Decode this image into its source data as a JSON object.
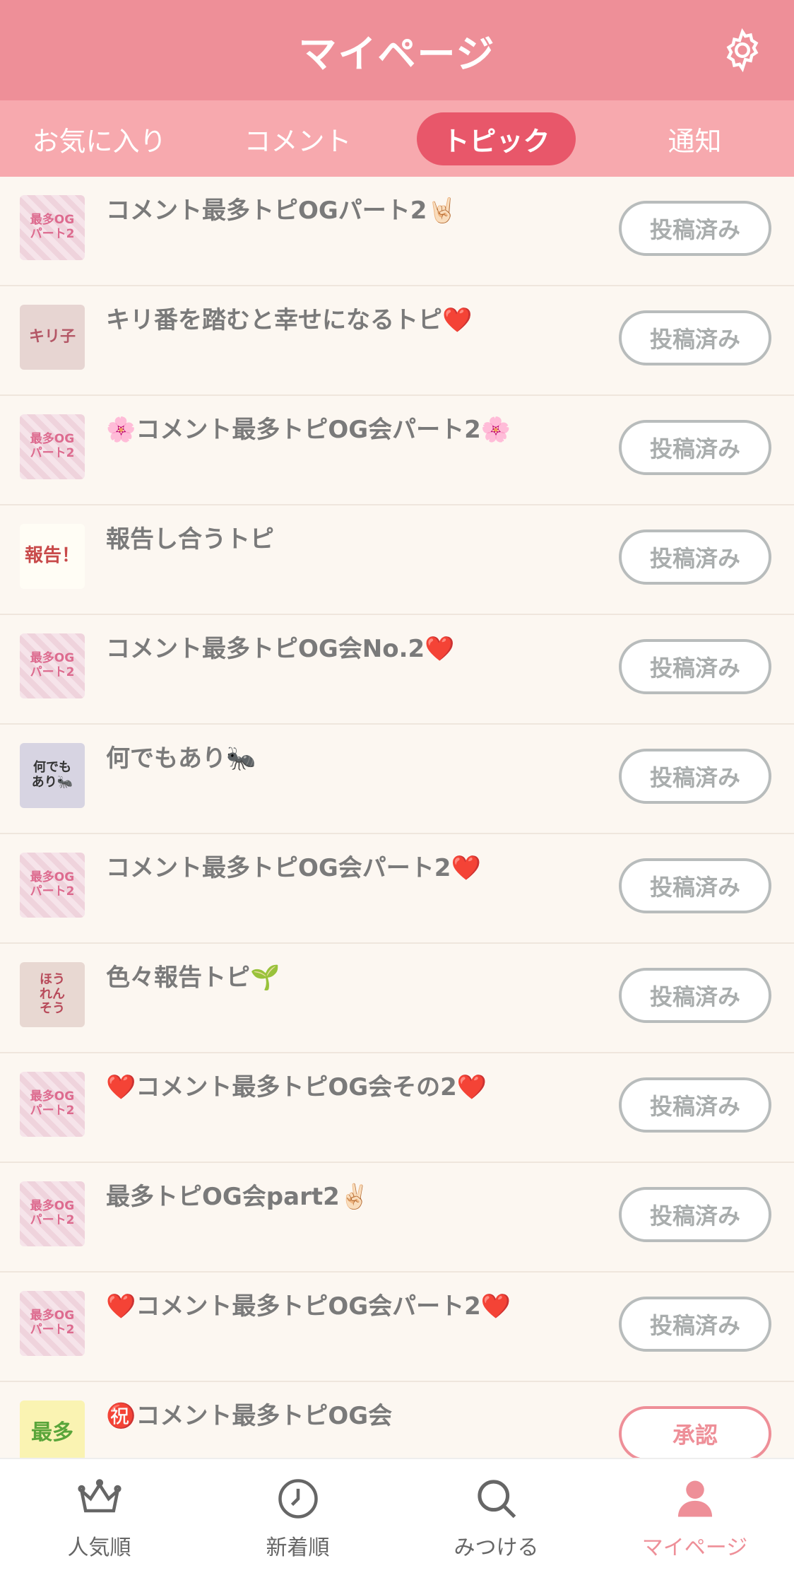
{
  "header": {
    "title": "マイページ",
    "settings_icon": "gear-icon"
  },
  "tabs": [
    {
      "label": "お気に入り",
      "active": false
    },
    {
      "label": "コメント",
      "active": false
    },
    {
      "label": "トピック",
      "active": true
    },
    {
      "label": "通知",
      "active": false
    }
  ],
  "topics": [
    {
      "thumb": "最多OG\nパート2",
      "title": "コメント最多トピOGパート2🤘🏻",
      "status": "投稿済み"
    },
    {
      "thumb": "キリ子",
      "title": "キリ番を踏むと幸せになるトピ❤️",
      "status": "投稿済み"
    },
    {
      "thumb": "最多OG\nパート2",
      "title": "🌸コメント最多トピOG会パート2🌸",
      "status": "投稿済み"
    },
    {
      "thumb": "報告！",
      "title": "報告し合うトピ",
      "status": "投稿済み"
    },
    {
      "thumb": "最多OG\nパート2",
      "title": "コメント最多トピOG会No.2❤️",
      "status": "投稿済み"
    },
    {
      "thumb": "何でも\nあり🐜",
      "title": "何でもあり🐜",
      "status": "投稿済み"
    },
    {
      "thumb": "最多OG\nパート2",
      "title": "コメント最多トピOG会パート2❤️",
      "status": "投稿済み"
    },
    {
      "thumb": "ほう\nれん\nそう",
      "title": "色々報告トピ🌱",
      "status": "投稿済み"
    },
    {
      "thumb": "最多OG\nパート2",
      "title": "❤️コメント最多トピOG会その2❤️",
      "status": "投稿済み"
    },
    {
      "thumb": "最多OG\nパート2",
      "title": "最多トピOG会part2✌🏻",
      "status": "投稿済み"
    },
    {
      "thumb": "最多OG\nパート2",
      "title": "❤️コメント最多トピOG会パート2❤️",
      "status": "投稿済み"
    },
    {
      "thumb": "最多",
      "title": "㊗️コメント最多トピOG会",
      "status": "承認"
    }
  ],
  "bottom_nav": [
    {
      "label": "人気順",
      "icon": "crown-icon",
      "active": false
    },
    {
      "label": "新着順",
      "icon": "clock-icon",
      "active": false
    },
    {
      "label": "みつける",
      "icon": "search-icon",
      "active": false
    },
    {
      "label": "マイページ",
      "icon": "person-icon",
      "active": true
    }
  ],
  "colors": {
    "header": "#ee8f98",
    "tabs": "#f7a9ae",
    "active_tab": "#e8576a",
    "accent": "#ee8f98"
  }
}
